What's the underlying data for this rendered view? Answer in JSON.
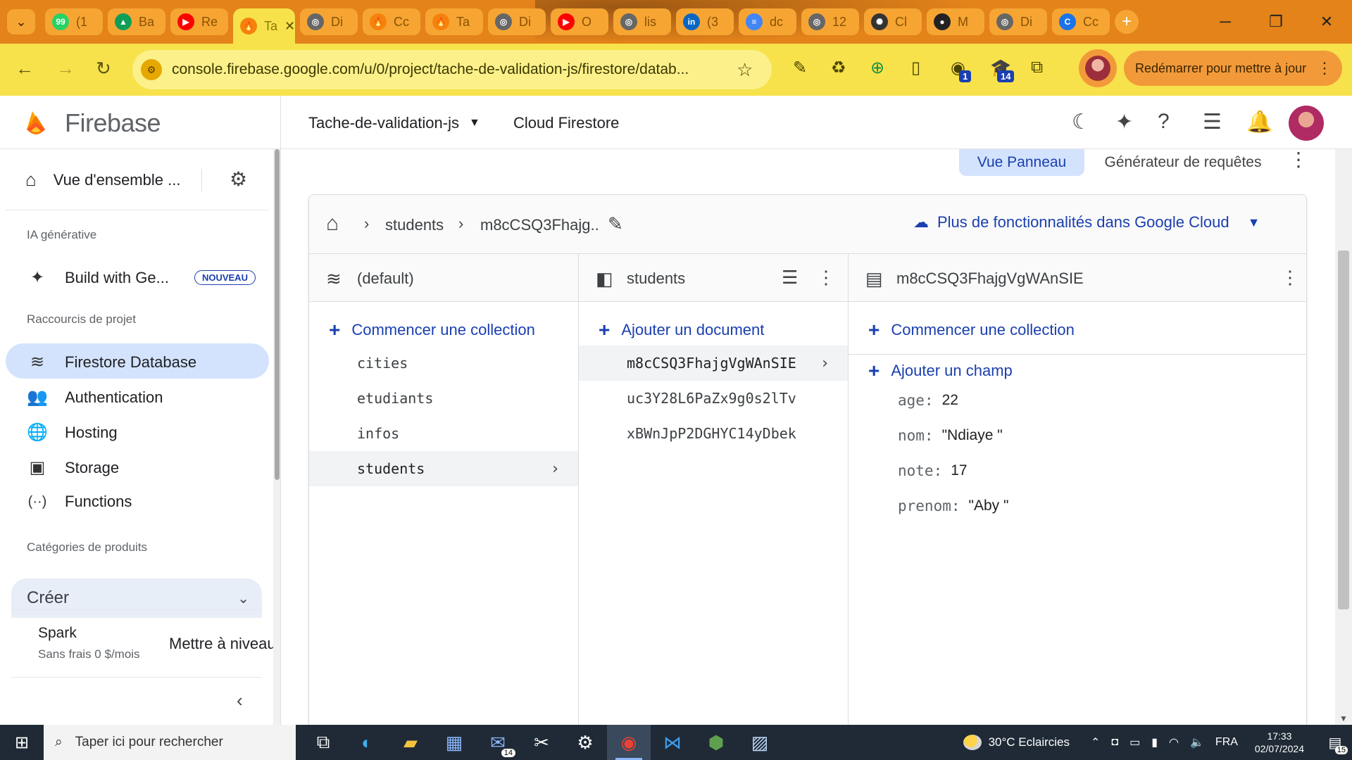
{
  "browser": {
    "tabs": [
      {
        "short": "(1",
        "fav_color": "#25d366",
        "fav_glyph": "99"
      },
      {
        "short": "Ba",
        "fav_color": "#0f9d58",
        "fav_glyph": "▲"
      },
      {
        "short": "Re",
        "fav_color": "#ff0000",
        "fav_glyph": "▶"
      },
      {
        "short": "Ta",
        "fav_color": "#f6820d",
        "fav_glyph": "🔥",
        "active": true,
        "close": "✕"
      },
      {
        "short": "Di",
        "fav_color": "#666666",
        "fav_glyph": "◎"
      },
      {
        "short": "Cc",
        "fav_color": "#f6820d",
        "fav_glyph": "🔥"
      },
      {
        "short": "Ta",
        "fav_color": "#f6820d",
        "fav_glyph": "🔥"
      },
      {
        "short": "Di",
        "fav_color": "#666666",
        "fav_glyph": "◎"
      },
      {
        "short": "O",
        "fav_color": "#ff0000",
        "fav_glyph": "▶"
      },
      {
        "short": "lis",
        "fav_color": "#666666",
        "fav_glyph": "◎"
      },
      {
        "short": "(3",
        "fav_color": "#0a66c2",
        "fav_glyph": "in"
      },
      {
        "short": "dc",
        "fav_color": "#4285f4",
        "fav_glyph": "≡"
      },
      {
        "short": "12",
        "fav_color": "#666666",
        "fav_glyph": "◎"
      },
      {
        "short": "Cl",
        "fav_color": "#333333",
        "fav_glyph": "✺"
      },
      {
        "short": "M",
        "fav_color": "#222222",
        "fav_glyph": "●"
      },
      {
        "short": "Di",
        "fav_color": "#666666",
        "fav_glyph": "◎"
      },
      {
        "short": "Cc",
        "fav_color": "#1a73e8",
        "fav_glyph": "C"
      }
    ],
    "url": "console.firebase.google.com/u/0/project/tache-de-validation-js/firestore/datab...",
    "restart_label": "Redémarrer pour mettre à jour",
    "ext_badges": {
      "badge_a": "1",
      "badge_b": "14"
    }
  },
  "header": {
    "brand": "Firebase",
    "project": "Tache-de-validation-js",
    "product": "Cloud Firestore"
  },
  "sidebar": {
    "overview": "Vue d'ensemble ...",
    "section_ai": "IA générative",
    "build_with": "Build with Ge...",
    "badge_new": "NOUVEAU",
    "section_shortcuts": "Raccourcis de projet",
    "items": [
      {
        "label": "Firestore Database",
        "icon": "firestore-icon"
      },
      {
        "label": "Authentication",
        "icon": "people-icon"
      },
      {
        "label": "Hosting",
        "icon": "globe-icon"
      },
      {
        "label": "Storage",
        "icon": "image-icon"
      },
      {
        "label": "Functions",
        "icon": "functions-icon"
      }
    ],
    "section_products": "Catégories de produits",
    "create": "Créer",
    "plan_name": "Spark",
    "plan_price": "Sans frais 0 $/mois",
    "upgrade": "Mettre à niveau"
  },
  "main": {
    "view_panel": "Vue Panneau",
    "query_builder": "Générateur de requêtes",
    "breadcrumb": [
      "students",
      "m8cCSQ3Fhajg.."
    ],
    "gcloud_link": "Plus de fonctionnalités dans Google Cloud",
    "col_root": {
      "title": "(default)",
      "add_label": "Commencer une collection",
      "collections": [
        "cities",
        "etudiants",
        "infos",
        "students"
      ]
    },
    "col_collection": {
      "title": "students",
      "add_label": "Ajouter un document",
      "documents": [
        "m8cCSQ3FhajgVgWAnSIE",
        "uc3Y28L6PaZx9g0s2lTv",
        "xBWnJpP2DGHYC14yDbek"
      ]
    },
    "col_document": {
      "title": "m8cCSQ3FhajgVgWAnSIE",
      "add_collection": "Commencer une collection",
      "add_field": "Ajouter un champ",
      "fields": [
        {
          "key": "age:",
          "value": "22"
        },
        {
          "key": "nom:",
          "value": "\"Ndiaye \""
        },
        {
          "key": "note:",
          "value": "17"
        },
        {
          "key": "prenom:",
          "value": "\"Aby \""
        }
      ]
    }
  },
  "taskbar": {
    "search_placeholder": "Taper ici pour rechercher",
    "mail_badge": "14",
    "weather": "30°C  Eclaircies",
    "lang": "FRA",
    "time": "17:33",
    "date": "02/07/2024",
    "notif_count": "15"
  },
  "colors": {
    "accent_blue": "#1a3fb0",
    "active_bg": "#d3e3fd",
    "tabstrip": "#e3831a",
    "addressbar": "#f7e24b"
  }
}
